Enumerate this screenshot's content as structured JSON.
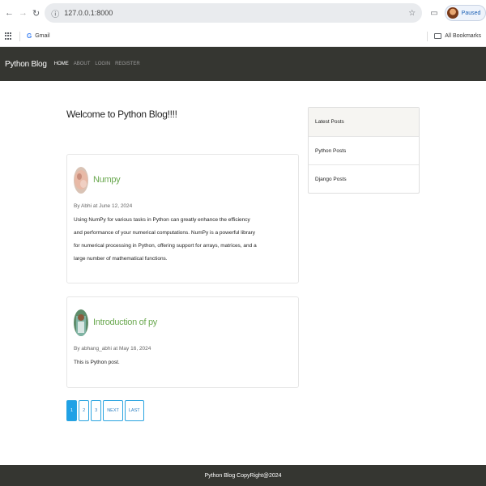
{
  "browser": {
    "url": "127.0.0.1:8000",
    "profile_label": "Paused",
    "bookmarks": [
      {
        "label": "Gmail"
      }
    ],
    "all_bookmarks_label": "All Bookmarks"
  },
  "navbar": {
    "brand": "Python Blog",
    "links": [
      {
        "label": "HOME"
      },
      {
        "label": "ABOUT"
      },
      {
        "label": "LOGIN"
      },
      {
        "label": "REGISTER"
      }
    ]
  },
  "main": {
    "welcome": "Welcome to Python Blog!!!!"
  },
  "posts": [
    {
      "title": "Numpy",
      "meta": "By Abhi at June 12, 2024",
      "body": "Using NumPy for various tasks in Python can greatly enhance the efficiency and performance of your numerical computations. NumPy is a powerful library for numerical processing in Python, offering support for arrays, matrices, and a large number of mathematical functions."
    },
    {
      "title": "Introduction of py",
      "meta": "By abhang_abhi at May 16, 2024",
      "body": "This is Python post."
    }
  ],
  "sidebar": {
    "header": "Latest Posts",
    "items": [
      {
        "label": "Python Posts"
      },
      {
        "label": "Django Posts"
      }
    ]
  },
  "pagination": {
    "pages": [
      "1",
      "2",
      "3"
    ],
    "current": "1",
    "next": "NEXT",
    "last": "LAST"
  },
  "footer": {
    "text": "Python Blog CopyRight@2024"
  },
  "colors": {
    "navbar_bg": "#353631",
    "title_green": "#6aa84f",
    "pager_blue": "#1fa1e6"
  }
}
